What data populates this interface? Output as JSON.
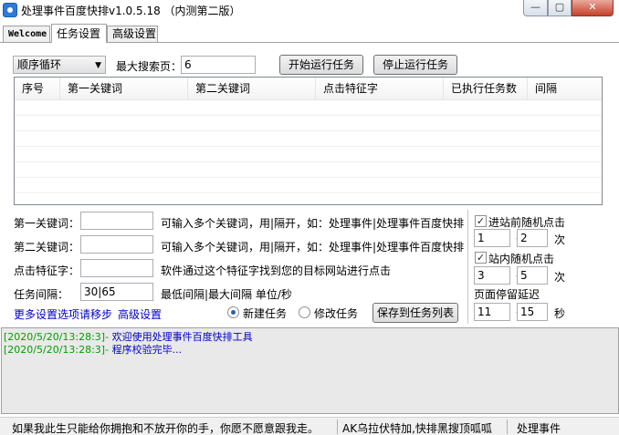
{
  "window": {
    "title": "处理事件百度快排v1.0.5.18 （内测第二版）",
    "minimize_glyph": "—",
    "maximize_glyph": "▢",
    "close_glyph": "✕"
  },
  "tabs": [
    {
      "label": "Welcome",
      "active": false
    },
    {
      "label": "任务设置",
      "active": true
    },
    {
      "label": "高级设置",
      "active": false
    }
  ],
  "task": {
    "mode_selected": "顺序循环",
    "max_search_pages_label": "最大搜索页：",
    "max_search_pages_value": "6",
    "start_label": "开始运行任务",
    "stop_label": "停止运行任务"
  },
  "grid": {
    "columns": [
      "序号",
      "第一关键词",
      "第二关键词",
      "点击特征字",
      "已执行任务数",
      "间隔"
    ],
    "rows": []
  },
  "form": {
    "kw1_label": "第一关键词：",
    "kw1_value": "",
    "kw1_hint": "可输入多个关键词，用|隔开，如：处理事件|处理事件百度快排",
    "kw2_label": "第二关键词：",
    "kw2_value": "",
    "kw2_hint": "可输入多个关键词，用|隔开，如：处理事件|处理事件百度快排",
    "feature_label": "点击特征字：",
    "feature_value": "",
    "feature_hint": "软件通过这个特征字找到您的目标网站进行点击",
    "interval_label": "任务间隔：",
    "interval_value": "30|65",
    "interval_hint": "最低间隔|最大间隔 单位/秒",
    "more_settings_link": "更多设置选项请移步",
    "advanced_link": "高级设置",
    "radio_new": "新建任务",
    "radio_edit": "修改任务",
    "save_label": "保存到任务列表"
  },
  "random": {
    "before_enter_label": "进站前随机点击",
    "before_enter_checked": true,
    "before_min": "1",
    "before_max": "2",
    "times_unit": "次",
    "inside_label": "站内随机点击",
    "inside_checked": true,
    "inside_min": "3",
    "inside_max": "5",
    "stay_label": "页面停留延迟",
    "stay_min": "11",
    "stay_max": "15",
    "seconds_unit": "秒",
    "dash": "—"
  },
  "log": [
    {
      "time": "[2020/5/20/13:28:3]-",
      "message": "欢迎使用处理事件百度快排工具"
    },
    {
      "time": "[2020/5/20/13:28:3]-",
      "message": "程序校验完毕..."
    }
  ],
  "statusbar": {
    "left": "如果我此生只能给你拥抱和不放开你的手，你愿不愿意跟我走。",
    "middle": "AK乌拉伏特加,快排黑搜顶呱呱",
    "right": "处理事件"
  },
  "icons": {
    "app": "app-icon",
    "dropdown": "chevron-down-icon",
    "check": "checkmark-icon"
  },
  "colors": {
    "log_timestamp": "#00a000",
    "log_message": "#0000c8",
    "link": "#0000c8",
    "close_button": "#c7402a"
  }
}
